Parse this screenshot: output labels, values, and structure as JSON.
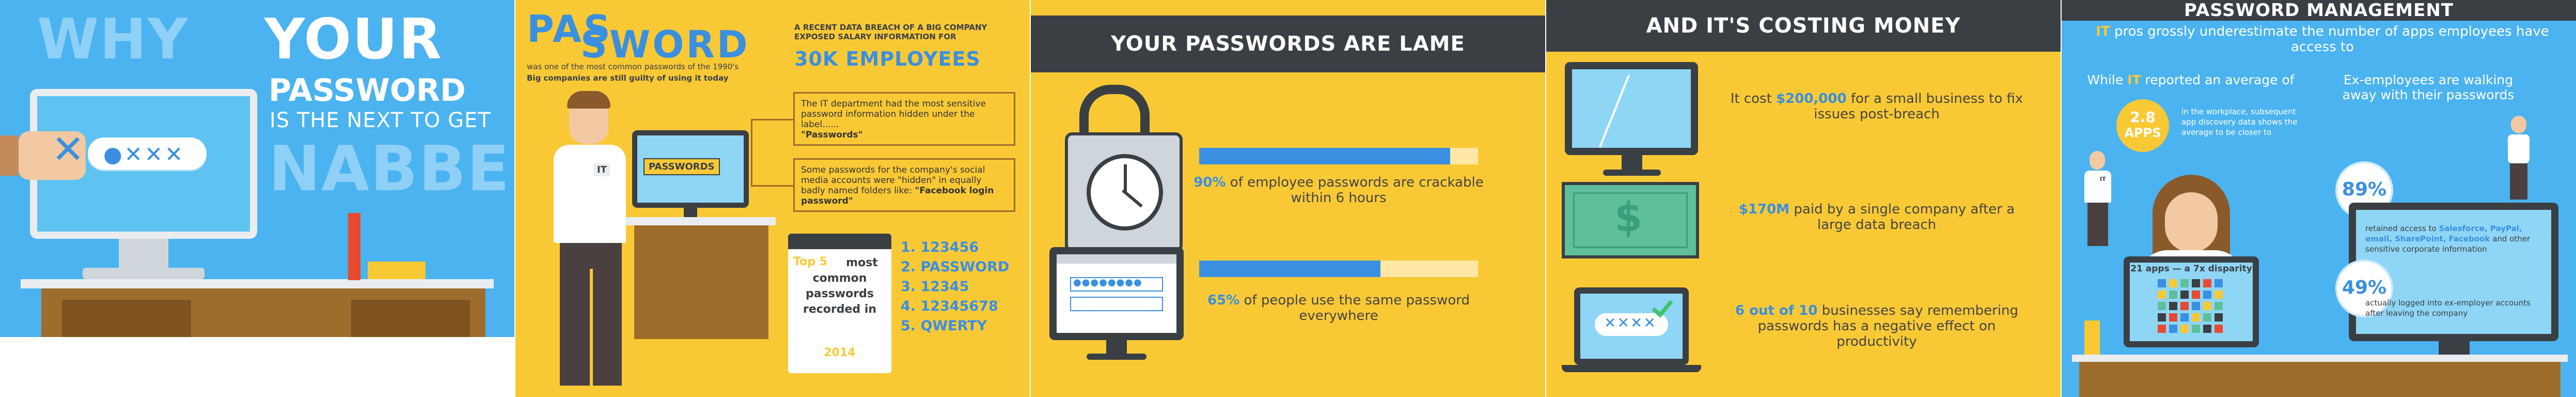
{
  "panel1": {
    "title_line1_a": "WHY",
    "title_line1_b": "YOUR",
    "title_line2": "PASSWORD",
    "title_line3": "IS THE NEXT TO GET",
    "title_line4": "NABBED",
    "input_x": "✕",
    "input_mask": "●✕✕✕"
  },
  "panel2": {
    "logo_top": "PAS",
    "logo_bottom": "SWORD",
    "intro_a": "was one of the most common passwords of the 1990's",
    "intro_b": "Big companies are still guilty of using it today",
    "breach_heading": "A RECENT DATA BREACH OF A BIG COMPANY EXPOSED SALARY INFORMATION FOR",
    "breach_count": "30K EMPLOYEES",
    "note1": "The IT department had the most sensitive password information hidden under the label......",
    "note1_bold": "\"Passwords\"",
    "note2": "Some passwords for the company's social media accounts were \"hidden\" in equally badly named folders like:",
    "note2_bold": "\"Facebook login password\"",
    "monitor_label": "PASSWORDS",
    "shirt_label": "IT",
    "calendar_top5": "Top 5",
    "calendar_rest": "most common passwords recorded in",
    "calendar_year": "2014",
    "top_passwords": [
      "1. 123456",
      "2. PASSWORD",
      "3. 12345",
      "4. 12345678",
      "5. QWERTY"
    ]
  },
  "panel3": {
    "header": "YOUR PASSWORDS ARE LAME",
    "stat1_pct": "90%",
    "stat1_text": " of employee passwords are crackable within 6 hours",
    "stat1_value": 0.9,
    "stat2_pct": "65%",
    "stat2_text": " of people use the same password everywhere",
    "stat2_value": 0.65,
    "login_mask": "●●●●●●●●"
  },
  "panel4": {
    "header": "AND IT'S COSTING MONEY",
    "stat1_pre": "It cost ",
    "stat1_hl": "$200,000",
    "stat1_post": " for a small business to fix issues post-breach",
    "stat2_hl": "$170M",
    "stat2_post": " paid by a single company after a large data breach",
    "stat3_hl": "6 out of 10",
    "stat3_post": " businesses say remembering passwords has a negative effect on productivity",
    "laptop_mask": "✕✕✕✕",
    "dollar": "$"
  },
  "panel5": {
    "header": "PASSWORD MANAGEMENT",
    "subtitle_it": "IT",
    "subtitle_rest": " pros grossly underestimate the number of apps employees have access to",
    "left_heading_pre": "While ",
    "left_heading_it": "IT",
    "left_heading_post": " reported an average of",
    "apps_bubble_num": "2.8",
    "apps_bubble_label": "APPS",
    "apps_detail": "in the workplace, subsequent app discovery data shows the average to be closer to",
    "monitor_caption": "21 apps — a 7x disparity",
    "right_heading": "Ex-employees are walking away with their passwords",
    "stat1_pct": "89%",
    "stat1_text_a": "retained access to ",
    "stat1_text_b": "Salesforce, PayPal, email, SharePoint, Facebook",
    "stat1_text_c": " and other sensitive corporate information",
    "stat2_pct": "49%",
    "stat2_text": "actually logged into ex-employer accounts after leaving the company",
    "shirt_label": "IT"
  },
  "colors": {
    "sky": "#4bb3f0",
    "yellow": "#f9c935",
    "dark": "#3a3f44",
    "accent_blue": "#3a8fe0"
  }
}
